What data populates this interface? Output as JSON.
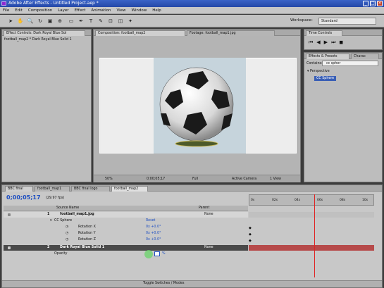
{
  "window": {
    "title": "Adobe After Effects - Untitled Project.aep *"
  },
  "menu": [
    "File",
    "Edit",
    "Composition",
    "Layer",
    "Effect",
    "Animation",
    "View",
    "Window",
    "Help"
  ],
  "toolbar": {
    "workspace_label": "Workspace:",
    "workspace_value": "Standard"
  },
  "effect_controls": {
    "tab": "Effect Controls: Dark Royal Blue Sol",
    "breadcrumb": "football_map2 * Dark Royal Blue Solid 1"
  },
  "composition": {
    "tab": "Composition: football_map2",
    "footage_tab": "Footage: football_map1.jpg",
    "zoom": "50%",
    "timecode": "0;00;05;17",
    "resolution": "Full",
    "camera": "Active Camera",
    "views": "1 View"
  },
  "time_controls": {
    "tab": "Time Controls"
  },
  "effects_presets": {
    "tab": "Effects & Presets",
    "tab2": "Charac",
    "search_label": "Contains:",
    "search_value": "cc spher",
    "category": "Perspective",
    "item": "CC Sphere"
  },
  "timeline": {
    "tabs": [
      "BBC final",
      "football_map1",
      "BBC final logo",
      "football_map2"
    ],
    "timecode": "0;00;05;17",
    "fps": "(29.97 fps)",
    "col_source": "Source Name",
    "col_parent": "Parent",
    "layers": [
      {
        "num": "1",
        "name": "football_map1.jpg",
        "parent": "None"
      },
      {
        "num": "2",
        "name": "Dark Royal Blue Solid 1",
        "parent": "None"
      }
    ],
    "effect_name": "CC Sphere",
    "effect_reset": "Reset",
    "rotations": [
      {
        "label": "Rotation X",
        "value": "0x +0.0°"
      },
      {
        "label": "Rotation Y",
        "value": "0x +0.0°"
      },
      {
        "label": "Rotation Z",
        "value": "0x +0.0°"
      }
    ],
    "opacity_label": "Opacity",
    "opacity_value": "%",
    "ruler": [
      "0s",
      "02s",
      "04s",
      "06s",
      "08s",
      "10s"
    ],
    "toggle_label": "Toggle Switches / Modes",
    "playhead_fraction": 0.52
  }
}
